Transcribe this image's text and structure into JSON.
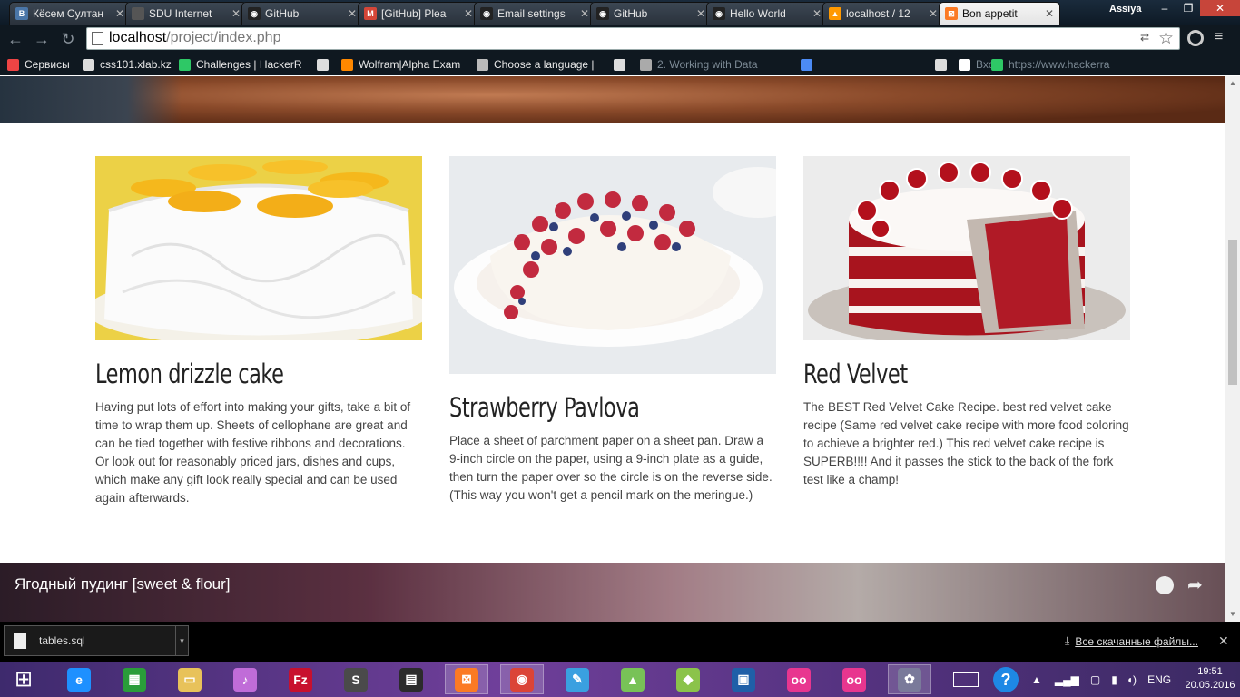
{
  "tabs": [
    {
      "label": "Кёсем Султан",
      "color": "#4a76a8",
      "glyph": "В"
    },
    {
      "label": "SDU Internet",
      "color": "#555",
      "glyph": ""
    },
    {
      "label": "GitHub",
      "color": "#222",
      "glyph": "◉"
    },
    {
      "label": "[GitHub] Plea",
      "color": "#d44638",
      "glyph": "M"
    },
    {
      "label": "Email settings",
      "color": "#222",
      "glyph": "◉"
    },
    {
      "label": "GitHub",
      "color": "#222",
      "glyph": "◉"
    },
    {
      "label": "Hello World",
      "color": "#222",
      "glyph": "◉"
    },
    {
      "label": "localhost / 12",
      "color": "#f90",
      "glyph": "▲"
    },
    {
      "label": "Bon appetit",
      "color": "#fb7a24",
      "glyph": "⊠",
      "active": true
    }
  ],
  "window": {
    "user": "Assiya",
    "minimize": "–",
    "maximize": "❐",
    "close": "✕"
  },
  "toolbar": {
    "back": "←",
    "forward": "→",
    "reload": "↻",
    "url_host": "localhost",
    "url_path": "/project/index.php",
    "translate_glyph": "⇄",
    "star_glyph": "☆",
    "menu_glyph": "≡"
  },
  "bookmarks": [
    {
      "label": "Сервисы",
      "color": "#e44"
    },
    {
      "label": "css101.xlab.kz",
      "color": "#ddd"
    },
    {
      "label": "Challenges | HackerR",
      "color": "#2ec866"
    },
    {
      "label": "",
      "color": "#ddd"
    },
    {
      "label": "Wolfram|Alpha Exam",
      "color": "#f80"
    },
    {
      "label": "Choose a language |",
      "color": "#bbb"
    },
    {
      "label": "",
      "color": "#ddd"
    },
    {
      "label": "2. Working with Data",
      "color": "#aaa",
      "dim": true
    },
    {
      "label": "",
      "color": "#4c8bf5"
    },
    {
      "label": "",
      "color": "#ddd"
    },
    {
      "label": "Вход",
      "color": "#fff",
      "dim": true
    },
    {
      "label": "https://www.hackerra",
      "color": "#2ec866",
      "dim": true
    }
  ],
  "cards": [
    {
      "title": "Lemon drizzle cake",
      "text": "Having put lots of effort into making your gifts, take a bit of time to wrap them up. Sheets of cellophane are great and can be tied together with festive ribbons and decorations. Or look out for reasonably priced jars, dishes and cups, which make any gift look really special and can be used again afterwards."
    },
    {
      "title": "Strawberry Pavlova",
      "text": "Place a sheet of parchment paper on a sheet pan. Draw a 9-inch circle on the paper, using a 9-inch plate as a guide, then turn the paper over so the circle is on the reverse side. (This way you won't get a pencil mark on the meringue.)"
    },
    {
      "title": "Red Velvet",
      "text": "The BEST Red Velvet Cake Recipe. best red velvet cake recipe (Same red velvet cake recipe with more food coloring to achieve a brighter red.) This red velvet cake recipe is SUPERB!!!! And it passes the stick to the back of the fork test like a champ!"
    }
  ],
  "video": {
    "title": "Ягодный пудинг [sweet & flour]",
    "share_glyph": "➦"
  },
  "scrollbar": {
    "up": "▲",
    "down": "▼"
  },
  "downloads": {
    "file": "tables.sql",
    "arrow": "▾",
    "all_label": "Все скачанные файлы...",
    "all_icon": "⤓",
    "close": "✕"
  },
  "taskbar": {
    "apps": [
      {
        "name": "start",
        "glyph": "⊞",
        "color": "transparent"
      },
      {
        "name": "internet-explorer",
        "glyph": "e",
        "color": "#1e90ff"
      },
      {
        "name": "store",
        "glyph": "▦",
        "color": "#2a9d3a"
      },
      {
        "name": "file-explorer",
        "glyph": "▭",
        "color": "#e8c25a"
      },
      {
        "name": "itunes",
        "glyph": "♪",
        "color": "#c06cd8"
      },
      {
        "name": "filezilla",
        "glyph": "Fz",
        "color": "#c8102e"
      },
      {
        "name": "sublime-text",
        "glyph": "S",
        "color": "#4a4a4a"
      },
      {
        "name": "terminal",
        "glyph": "▤",
        "color": "#2b2b2b"
      },
      {
        "name": "xampp",
        "glyph": "⊠",
        "color": "#fb7a24"
      },
      {
        "name": "chrome",
        "glyph": "◉",
        "color": "#db4437"
      },
      {
        "name": "paint",
        "glyph": "✎",
        "color": "#3aa0e0"
      },
      {
        "name": "android-studio",
        "glyph": "▲",
        "color": "#78c257"
      },
      {
        "name": "android-sdk",
        "glyph": "◆",
        "color": "#8bc34a"
      },
      {
        "name": "virtualbox",
        "glyph": "▣",
        "color": "#1f5fa8"
      },
      {
        "name": "flickr",
        "glyph": "oo",
        "color": "#e8368f"
      },
      {
        "name": "flickr-2",
        "glyph": "oo",
        "color": "#e8368f"
      },
      {
        "name": "paint-2",
        "glyph": "✿",
        "color": "#7a7a9a"
      }
    ],
    "lang": "ENG",
    "time": "19:51",
    "date": "20.05.2016",
    "help": "?"
  }
}
